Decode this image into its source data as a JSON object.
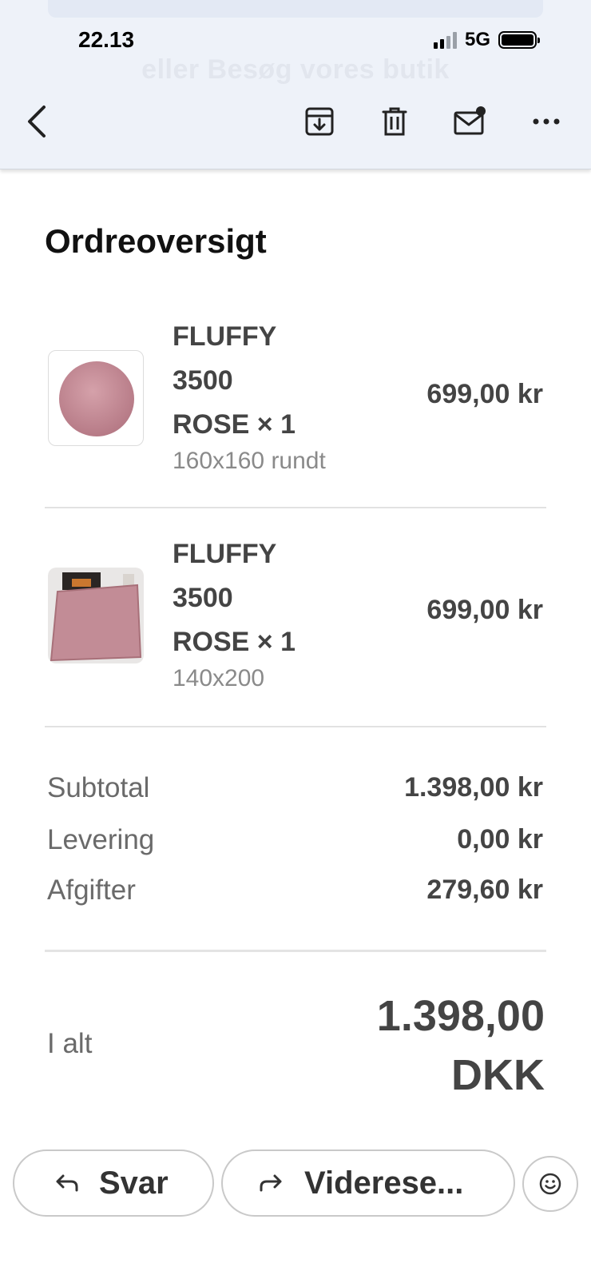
{
  "status": {
    "time": "22.13",
    "network": "5G"
  },
  "header": {
    "ghost_text": "eller Besøg vores butik",
    "icons": [
      "back-icon",
      "archive-icon",
      "trash-icon",
      "mark-unread-icon",
      "more-icon"
    ]
  },
  "summary": {
    "title": "Ordreoversigt",
    "items": [
      {
        "name_line1": "FLUFFY",
        "name_line2": "3500",
        "name_line3": "ROSE × 1",
        "variant": "160x160 rundt",
        "price": "699,00 kr"
      },
      {
        "name_line1": "FLUFFY",
        "name_line2": "3500",
        "name_line3": "ROSE × 1",
        "variant": "140x200",
        "price": "699,00 kr"
      }
    ],
    "rows": [
      {
        "label": "Subtotal",
        "value": "1.398,00 kr"
      },
      {
        "label": "Levering",
        "value": "0,00 kr"
      },
      {
        "label": "Afgifter",
        "value": "279,60 kr"
      }
    ],
    "total": {
      "label": "I alt",
      "amount": "1.398,00",
      "currency": "DKK"
    }
  },
  "actions": {
    "reply": "Svar",
    "forward": "Viderese...",
    "emoji_icon": "smiley-icon"
  },
  "colors": {
    "rug_rose": "#c78d98",
    "header_bg": "#eef2f9",
    "text_dark": "#444444",
    "text_muted": "#6a6a6a"
  }
}
